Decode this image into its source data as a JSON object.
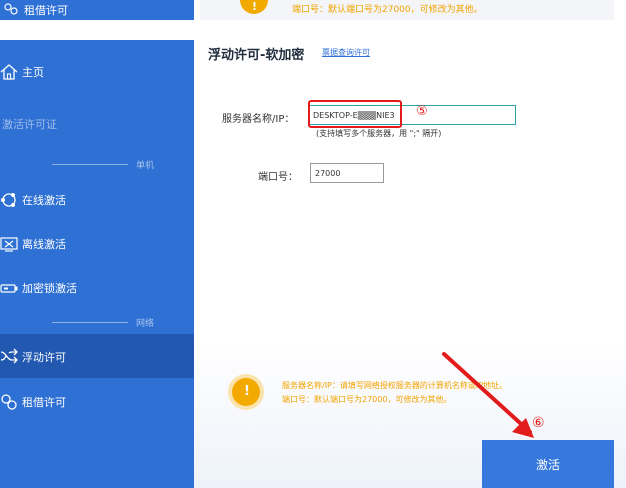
{
  "top": {
    "left_item_label": "租借许可",
    "notice_text": "端口号：默认端口号为27000，可修改为其他。",
    "warn_glyph": "!"
  },
  "sidebar": {
    "home_label": "主页",
    "section_label": "激活许可证",
    "divider_single": "单机",
    "online_label": "在线激活",
    "offline_label": "离线激活",
    "dongle_label": "加密锁激活",
    "divider_network": "网络",
    "floating_label": "浮动许可",
    "borrow_label": "租借许可",
    "bg_color": "#2e70d3",
    "active_color": "#2258b0"
  },
  "main": {
    "title": "浮动许可-软加密",
    "query_link": "票据查询许可",
    "server_label": "服务器名称/IP：",
    "server_value": "DESKTOP-E▒▒▒NIE3",
    "server_hint": "(支持填写多个服务器，用 \";\" 隔开)",
    "port_label": "端口号：",
    "port_value": "27000",
    "notice_line1": "服务器名称/IP：请填写网络授权服务器的计算机名称或IP地址。",
    "notice_line2": "端口号：默认端口号为27000，可修改为其他。",
    "warn_glyph": "!",
    "activate_label": "激活",
    "step5": "⑤",
    "step6": "⑥",
    "accent_color": "#3678dc",
    "annotation_color": "#e21c1c",
    "notice_color": "#f3a300"
  }
}
